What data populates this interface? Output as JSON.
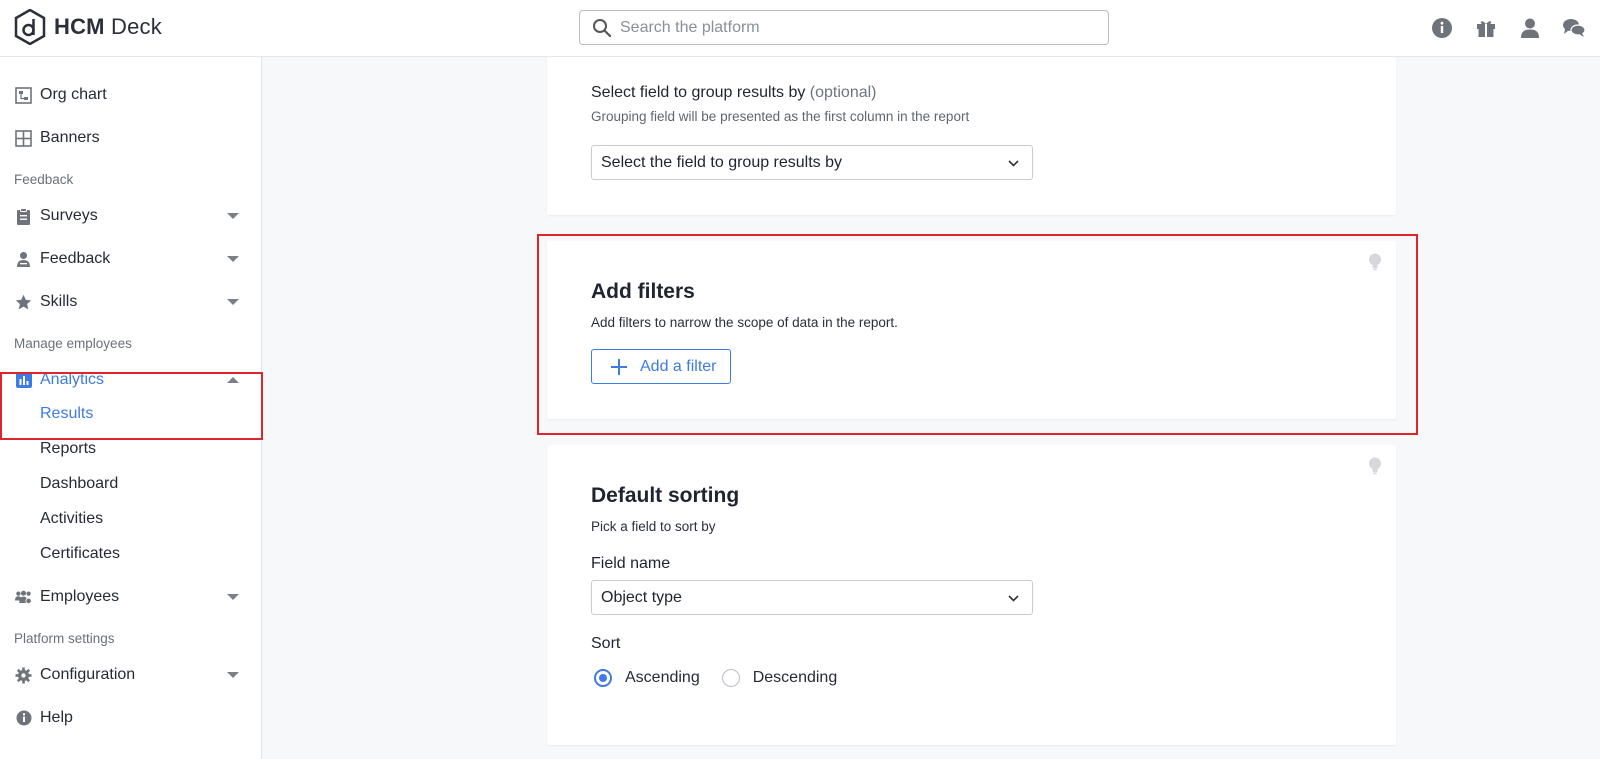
{
  "app": {
    "logo_bold": "HCM",
    "logo_rest": " Deck"
  },
  "search": {
    "placeholder": "Search the platform"
  },
  "topbar_icons": [
    "info-icon",
    "gift-icon",
    "user-icon",
    "chat-icon"
  ],
  "sidebar": {
    "items_top": [
      {
        "label": "Org chart",
        "icon": "org-chart-icon"
      },
      {
        "label": "Banners",
        "icon": "banners-icon"
      }
    ],
    "section_feedback": "Feedback",
    "feedback_items": [
      {
        "label": "Surveys",
        "icon": "clipboard-icon"
      },
      {
        "label": "Feedback",
        "icon": "person-feedback-icon"
      },
      {
        "label": "Skills",
        "icon": "star-icon"
      }
    ],
    "section_manage": "Manage employees",
    "analytics": {
      "label": "Analytics",
      "icon": "bar-chart-icon"
    },
    "analytics_sub": [
      "Results",
      "Reports",
      "Dashboard",
      "Activities",
      "Certificates"
    ],
    "employees": {
      "label": "Employees",
      "icon": "people-icon"
    },
    "section_platform": "Platform settings",
    "configuration": {
      "label": "Configuration",
      "icon": "gear-icon"
    },
    "help": {
      "label": "Help",
      "icon": "info-icon"
    }
  },
  "group_card": {
    "title": "Select field to group results by",
    "title_optional": "(optional)",
    "help": "Grouping field will be presented as the first column in the report",
    "select_value": "Select the field to group results by"
  },
  "filters_card": {
    "title": "Add filters",
    "help": "Add filters to narrow the scope of data in the report.",
    "button_label": "Add a filter"
  },
  "sorting_card": {
    "title": "Default sorting",
    "help": "Pick a field to sort by",
    "field_label": "Field name",
    "field_value": "Object type",
    "sort_label": "Sort",
    "options": [
      "Ascending",
      "Descending"
    ],
    "selected": "Ascending"
  },
  "colors": {
    "accent": "#3f7be0",
    "highlight": "#e0242b"
  }
}
